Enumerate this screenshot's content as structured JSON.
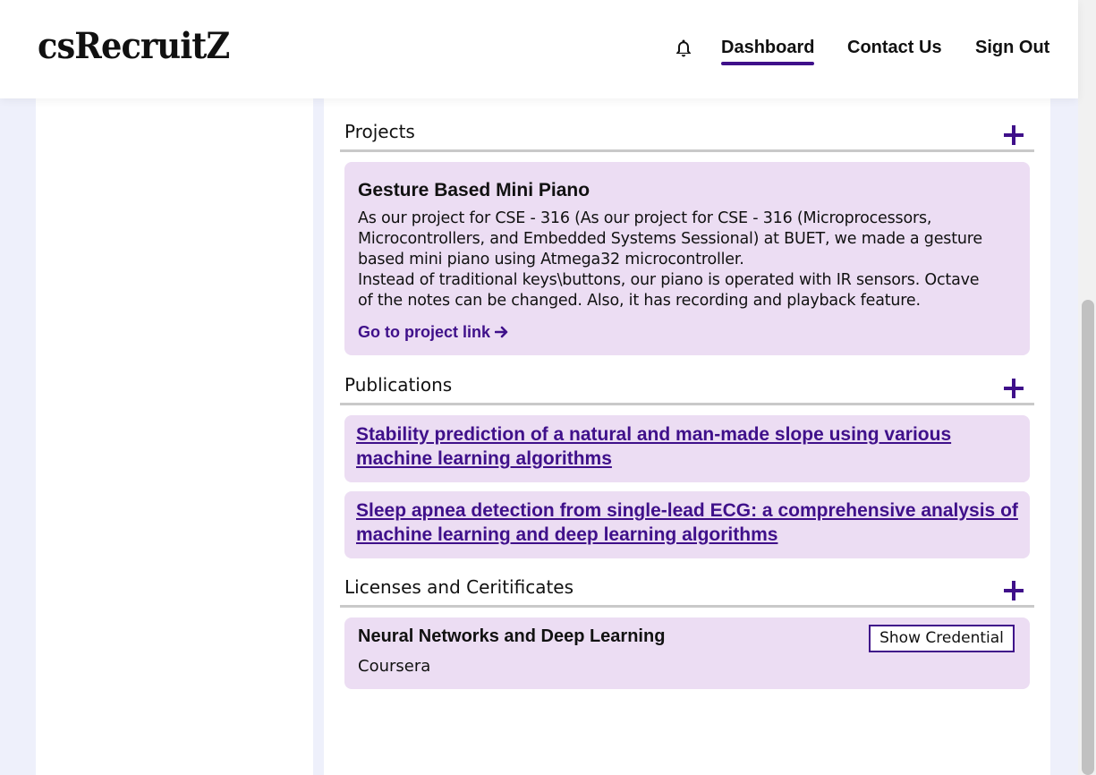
{
  "header": {
    "logo": "csRecruitZ",
    "nav": {
      "notifications_icon": "bell-icon",
      "dashboard": "Dashboard",
      "contact": "Contact Us",
      "signout": "Sign Out"
    }
  },
  "projects": {
    "title": "Projects",
    "add_icon": "plus-icon",
    "items": [
      {
        "title": "Gesture Based Mini Piano",
        "description_lines": [
          "As our project for CSE - 316 (As our project for CSE - 316 (Microprocessors,",
          "Microcontrollers, and Embedded Systems Sessional) at BUET, we made a gesture",
          "based mini piano using Atmega32 microcontroller.",
          "Instead of traditional keys\\buttons, our piano is operated with IR sensors. Octave",
          "of the notes can be changed. Also, it has recording and playback feature."
        ],
        "link_label": "Go to project link",
        "link_icon": "arrow-right-icon"
      }
    ]
  },
  "publications": {
    "title": "Publications",
    "add_icon": "plus-icon",
    "items": [
      {
        "title": "Stability prediction of a natural and man-made slope using various machine learning algorithms"
      },
      {
        "title": "Sleep apnea detection from single-lead ECG: a comprehensive analysis of machine learning and deep learning algorithms"
      }
    ]
  },
  "licenses": {
    "title": "Licenses and Ceritificates",
    "add_icon": "plus-icon",
    "items": [
      {
        "title": "Neural Networks and Deep Learning",
        "issuer": "Coursera",
        "button": "Show Credential"
      }
    ]
  },
  "colors": {
    "accent": "#3f108a",
    "card_bg": "#ecddf3",
    "page_bg": "#eef0fb"
  }
}
